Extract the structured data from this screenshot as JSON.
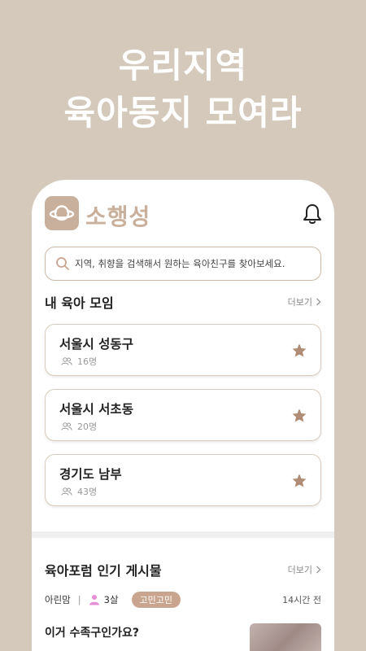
{
  "headline": {
    "line1": "우리지역",
    "line2": "육아동지 모여라"
  },
  "app": {
    "name": "소행성"
  },
  "search": {
    "placeholder": "지역, 취향을 검색해서 원하는 육아친구를 찾아보세요."
  },
  "my_groups": {
    "title": "내 육아 모임",
    "more_label": "더보기",
    "items": [
      {
        "name": "서울시 성동구",
        "members": "16명",
        "favorite": true
      },
      {
        "name": "서울시 서초동",
        "members": "20명",
        "favorite": true
      },
      {
        "name": "경기도 남부",
        "members": "43명",
        "favorite": true
      }
    ]
  },
  "popular_posts": {
    "title": "육아포럼 인기 게시물",
    "more_label": "더보기",
    "post": {
      "author": "아린맘",
      "separator": "|",
      "kid_age": "3살",
      "tag": "고민고민",
      "time": "14시간 전",
      "title": "이거 수족구인가요?"
    }
  },
  "colors": {
    "background": "#d5c9bc",
    "accent": "#c9b09c",
    "tag": "#c9a58f",
    "star": "#b08d74",
    "kid_icon": "#e58fd6"
  },
  "icons": {
    "logo": "planet-icon",
    "bell": "bell-icon",
    "search": "search-icon",
    "members": "people-icon",
    "favorite": "star-icon",
    "more": "chevron-right-icon",
    "kid": "person-icon"
  }
}
